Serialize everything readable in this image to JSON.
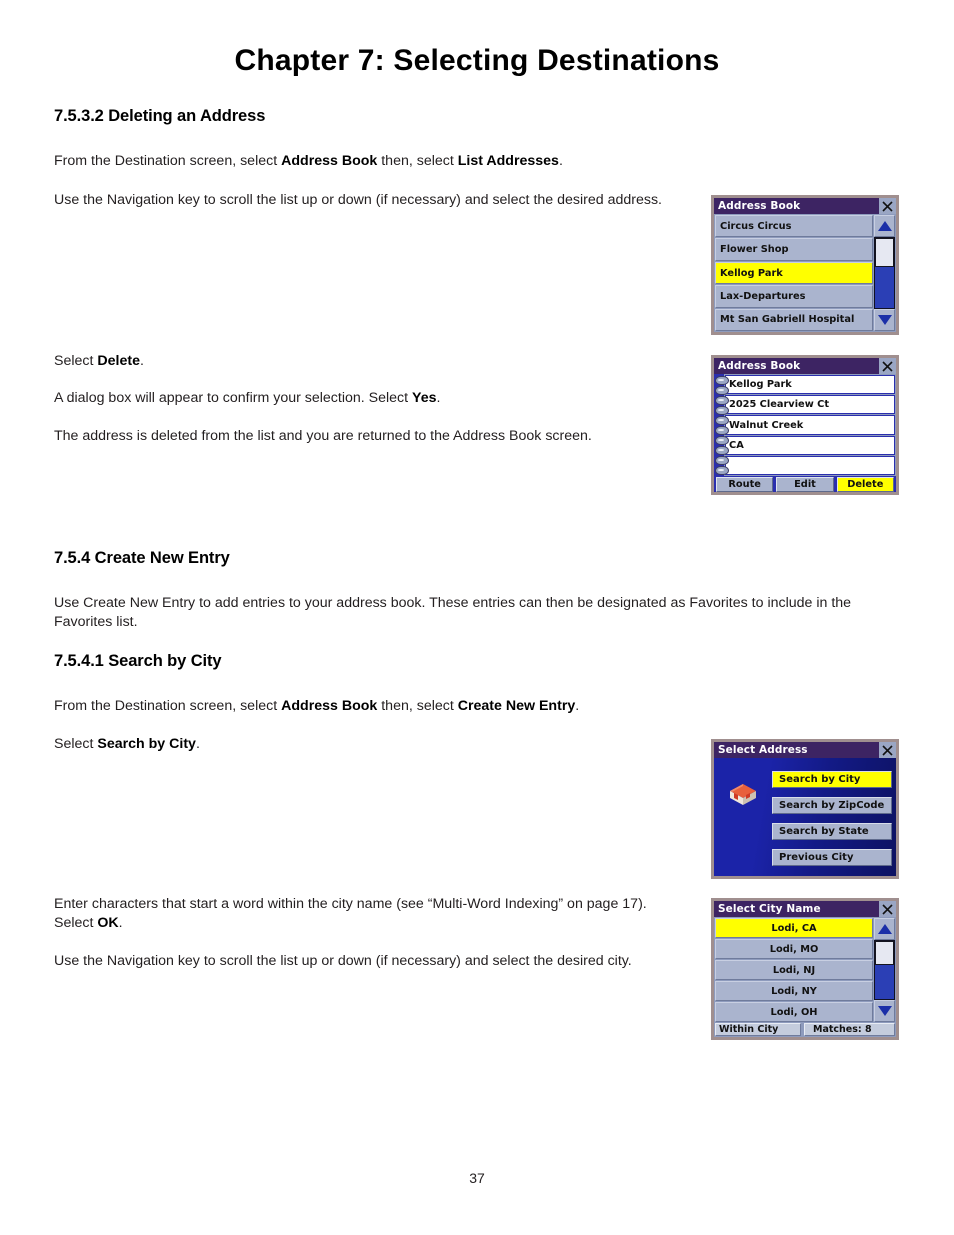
{
  "document": {
    "chapter_title": "Chapter 7: Selecting Destinations",
    "page_number": "37",
    "sections": {
      "deleting": {
        "heading": "7.5.3.2 Deleting an Address",
        "p1_a": "From the Destination screen, select ",
        "p1_b": "Address Book",
        "p1_c": " then, select ",
        "p1_d": "List Addresses",
        "p1_e": ".",
        "p2": "Use the Navigation key to scroll the list up or down (if necessary) and select the desired address.",
        "p3_a": "Select ",
        "p3_b": "Delete",
        "p3_c": ".",
        "p4_a": "A dialog box will appear to confirm your selection. Select ",
        "p4_b": "Yes",
        "p4_c": ".",
        "p5": "The address is deleted from the list and you are returned to the Address Book screen."
      },
      "create_new_entry": {
        "heading": "7.5.4 Create New Entry",
        "p1": "Use Create New Entry to add entries to your address book. These entries can then be designated as Favorites to include in the Favorites list."
      },
      "search_by_city": {
        "heading": "7.5.4.1 Search by City",
        "p1_a": "From the Destination screen, select ",
        "p1_b": "Address Book",
        "p1_c": " then, select ",
        "p1_d": "Create New Entry",
        "p1_e": ".",
        "p2_a": "Select ",
        "p2_b": "Search by City",
        "p2_c": ".",
        "p3_a": "Enter characters that start a word within the city name (see “Multi-Word Indexing” on page 17). Select ",
        "p3_b": "OK",
        "p3_c": ".",
        "p4": "Use the Navigation key to scroll the list up or down (if necessary) and select the desired city."
      }
    }
  },
  "screenshots": {
    "address_book_list": {
      "title": "Address Book",
      "close_icon": "close-x-icon",
      "rows": [
        {
          "label": "Circus Circus",
          "selected": false
        },
        {
          "label": "Flower Shop",
          "selected": false
        },
        {
          "label": "Kellog Park",
          "selected": true
        },
        {
          "label": "Lax-Departures",
          "selected": false
        },
        {
          "label": "Mt San Gabriell Hospital",
          "selected": false
        }
      ],
      "scroll_up_icon": "triangle-up-icon",
      "scroll_down_icon": "triangle-down-icon"
    },
    "address_book_record": {
      "title": "Address Book",
      "close_icon": "close-x-icon",
      "fields": [
        "Kellog Park",
        "2025 Clearview Ct",
        "Walnut Creek",
        "CA",
        ""
      ],
      "buttons": [
        {
          "label": "Route",
          "highlighted": false
        },
        {
          "label": "Edit",
          "highlighted": false
        },
        {
          "label": "Delete",
          "highlighted": true
        }
      ]
    },
    "select_address": {
      "title": "Select Address",
      "close_icon": "close-x-icon",
      "house_icon": "house-icon",
      "items": [
        {
          "label": "Search by City",
          "highlighted": true
        },
        {
          "label": "Search by ZipCode",
          "highlighted": false
        },
        {
          "label": "Search by State",
          "highlighted": false
        },
        {
          "label": "Previous City",
          "highlighted": false
        }
      ]
    },
    "select_city_name": {
      "title": "Select City Name",
      "close_icon": "close-x-icon",
      "rows": [
        {
          "label": "Lodi, CA",
          "selected": true
        },
        {
          "label": "Lodi, MO",
          "selected": false
        },
        {
          "label": "Lodi, NJ",
          "selected": false
        },
        {
          "label": "Lodi, NY",
          "selected": false
        },
        {
          "label": "Lodi, OH",
          "selected": false
        }
      ],
      "scroll_up_icon": "triangle-up-icon",
      "scroll_down_icon": "triangle-down-icon",
      "status_left": "Within City",
      "status_right": "Matches: 8"
    }
  }
}
